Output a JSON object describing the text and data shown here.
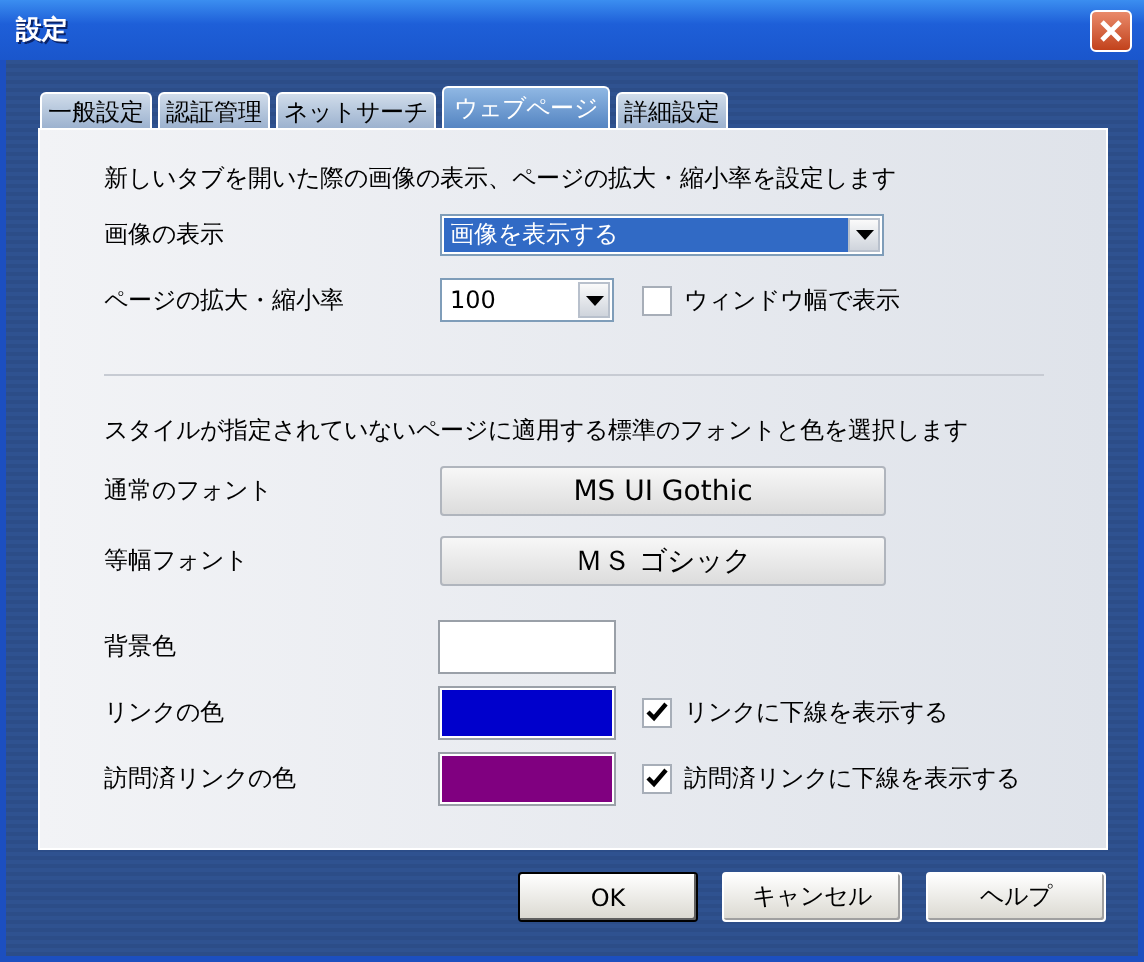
{
  "window": {
    "title": "設定"
  },
  "tabs": [
    {
      "label": "一般設定",
      "selected": false
    },
    {
      "label": "認証管理",
      "selected": false
    },
    {
      "label": "ネットサーチ",
      "selected": false
    },
    {
      "label": "ウェブページ",
      "selected": true
    },
    {
      "label": "詳細設定",
      "selected": false
    }
  ],
  "web_page": {
    "intro": "新しいタブを開いた際の画像の表示、ページの拡大・縮小率を設定します",
    "image_display": {
      "label": "画像の表示",
      "value": "画像を表示する"
    },
    "zoom": {
      "label": "ページの拡大・縮小率",
      "value": "100",
      "fit_window": {
        "label": "ウィンドウ幅で表示",
        "checked": false
      }
    },
    "font_intro": "スタイルが指定されていないページに適用する標準のフォントと色を選択します",
    "fonts": [
      {
        "label": "通常のフォント",
        "value": "MS UI Gothic"
      },
      {
        "label": "等幅フォント",
        "value": "ＭＳ ゴシック"
      }
    ],
    "colors": [
      {
        "label": "背景色",
        "color": "#ffffff"
      },
      {
        "label": "リンクの色",
        "color": "#0000cc",
        "underline": {
          "label": "リンクに下線を表示する",
          "checked": true
        }
      },
      {
        "label": "訪問済リンクの色",
        "color": "#800080",
        "underline": {
          "label": "訪問済リンクに下線を表示する",
          "checked": true
        }
      }
    ]
  },
  "buttons": [
    {
      "label": "OK",
      "default": true
    },
    {
      "label": "キャンセル",
      "default": false
    },
    {
      "label": "ヘルプ",
      "default": false
    }
  ]
}
